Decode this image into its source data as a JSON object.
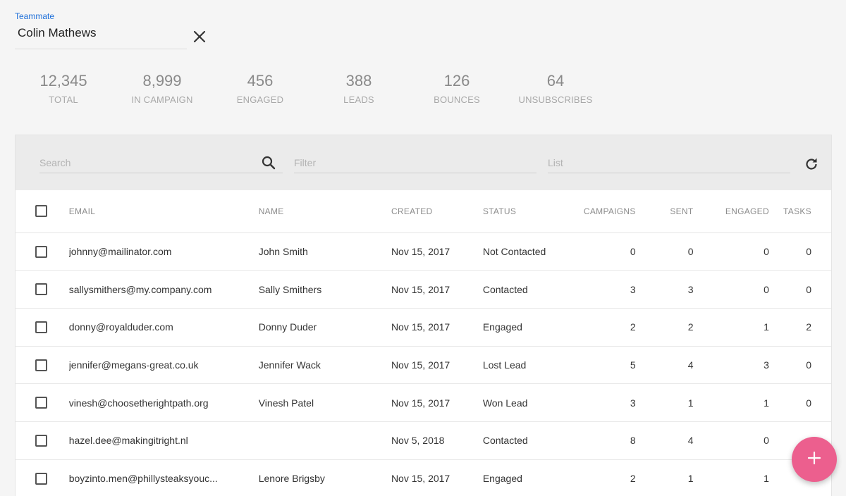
{
  "teammate": {
    "label": "Teammate",
    "value": "Colin Mathews"
  },
  "stats": [
    {
      "value": "12,345",
      "label": "TOTAL"
    },
    {
      "value": "8,999",
      "label": "IN CAMPAIGN"
    },
    {
      "value": "456",
      "label": "ENGAGED"
    },
    {
      "value": "388",
      "label": "LEADS"
    },
    {
      "value": "126",
      "label": "BOUNCES"
    },
    {
      "value": "64",
      "label": "UNSUBSCRIBES"
    }
  ],
  "toolbar": {
    "search_placeholder": "Search",
    "filter_placeholder": "Filter",
    "list_placeholder": "List"
  },
  "table": {
    "headers": {
      "email": "EMAIL",
      "name": "NAME",
      "created": "CREATED",
      "status": "STATUS",
      "campaigns": "CAMPAIGNS",
      "sent": "SENT",
      "engaged": "ENGAGED",
      "tasks": "TASKS"
    },
    "rows": [
      {
        "email": "johnny@mailinator.com",
        "name": "John Smith",
        "created": "Nov 15, 2017",
        "status": "Not Contacted",
        "campaigns": "0",
        "sent": "0",
        "engaged": "0",
        "tasks": "0"
      },
      {
        "email": "sallysmithers@my.company.com",
        "name": "Sally Smithers",
        "created": "Nov 15, 2017",
        "status": "Contacted",
        "campaigns": "3",
        "sent": "3",
        "engaged": "0",
        "tasks": "0"
      },
      {
        "email": "donny@royalduder.com",
        "name": "Donny Duder",
        "created": "Nov 15, 2017",
        "status": "Engaged",
        "campaigns": "2",
        "sent": "2",
        "engaged": "1",
        "tasks": "2"
      },
      {
        "email": "jennifer@megans-great.co.uk",
        "name": "Jennifer Wack",
        "created": "Nov 15, 2017",
        "status": "Lost Lead",
        "campaigns": "5",
        "sent": "4",
        "engaged": "3",
        "tasks": "0"
      },
      {
        "email": "vinesh@choosetherightpath.org",
        "name": "Vinesh Patel",
        "created": "Nov 15, 2017",
        "status": "Won Lead",
        "campaigns": "3",
        "sent": "1",
        "engaged": "1",
        "tasks": "0"
      },
      {
        "email": "hazel.dee@makingitright.nl",
        "name": "",
        "created": "Nov 5, 2018",
        "status": "Contacted",
        "campaigns": "8",
        "sent": "4",
        "engaged": "0",
        "tasks": ""
      },
      {
        "email": "boyzinto.men@phillysteaksyouc...",
        "name": "Lenore Brigsby",
        "created": "Nov 15, 2017",
        "status": "Engaged",
        "campaigns": "2",
        "sent": "1",
        "engaged": "1",
        "tasks": ""
      }
    ]
  },
  "colors": {
    "accent": "#1e6fd9",
    "fab": "#ec5f8e",
    "toolbar_bg": "#ebebeb"
  },
  "icons": {
    "clear": "close-icon",
    "search": "search-icon",
    "refresh": "refresh-icon",
    "fab": "plus-icon"
  }
}
